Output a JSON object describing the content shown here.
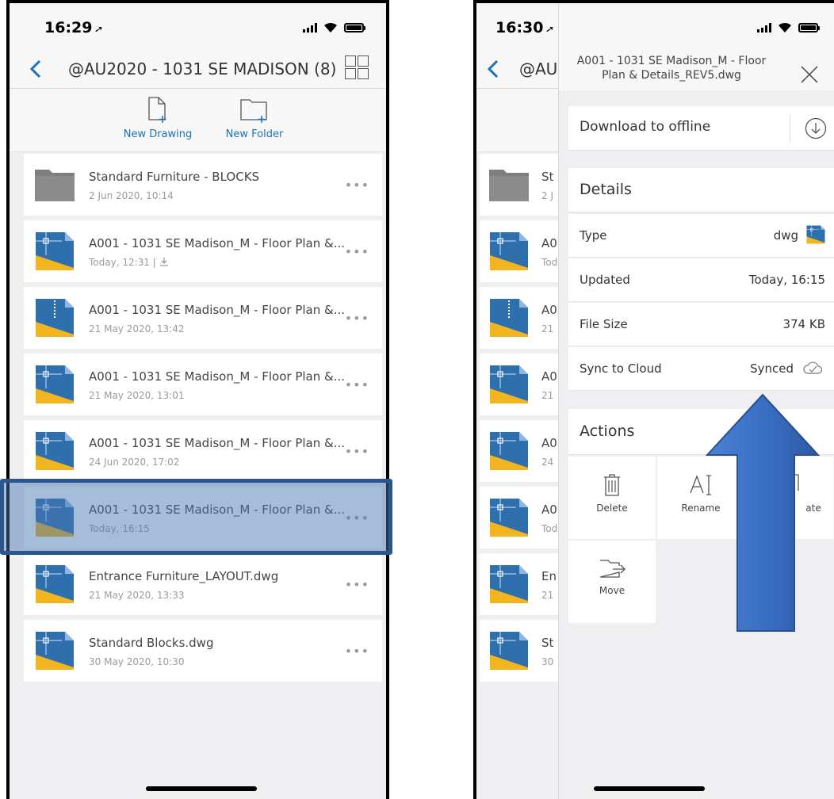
{
  "left_phone": {
    "status": {
      "time": "16:29",
      "location_glyph": "➚"
    },
    "nav": {
      "title": "@AU2020 - 1031 SE MADISON (8)"
    },
    "toolbar": {
      "new_drawing": "New Drawing",
      "new_folder": "New Folder"
    },
    "rows": [
      {
        "name": "Standard Furniture - BLOCKS",
        "date": "2 Jun 2020, 10:14",
        "icon": "folder-icon"
      },
      {
        "name": "A001 - 1031 SE Madison_M - Floor Plan &...",
        "date": "Today, 12:31  |",
        "icon": "dwg-file-icon",
        "downloaded": true
      },
      {
        "name": "A001 - 1031 SE Madison_M - Floor Plan &...",
        "date": "21 May 2020, 13:42",
        "icon": "dwg-zip-icon"
      },
      {
        "name": "A001 - 1031 SE Madison_M - Floor Plan &...",
        "date": "21 May 2020, 13:01",
        "icon": "dwg-file-icon"
      },
      {
        "name": "A001 - 1031 SE Madison_M - Floor Plan &...",
        "date": "24 Jun 2020, 17:02",
        "icon": "dwg-file-icon"
      },
      {
        "name": "A001 - 1031 SE Madison_M - Floor Plan &...",
        "date": "Today, 16:15",
        "icon": "dwg-file-icon",
        "selected": true
      },
      {
        "name": "Entrance Furniture_LAYOUT.dwg",
        "date": "21 May 2020, 13:33",
        "icon": "dwg-file-icon"
      },
      {
        "name": "Standard Blocks.dwg",
        "date": "30 May 2020, 10:30",
        "icon": "dwg-file-icon"
      }
    ],
    "more_glyph": "•••"
  },
  "right_phone": {
    "status": {
      "time": "16:30",
      "location_glyph": "➚"
    },
    "nav": {
      "title_partial": "@AU"
    },
    "bg_rows": [
      {
        "name": "St",
        "date": "2 J"
      },
      {
        "name": "A0",
        "date": "Tod"
      },
      {
        "name": "A0",
        "date": "21"
      },
      {
        "name": "A0",
        "date": "21"
      },
      {
        "name": "A0",
        "date": "24"
      },
      {
        "name": "A0",
        "date": "Tod"
      },
      {
        "name": "En",
        "date": "21"
      },
      {
        "name": "St",
        "date": "30"
      }
    ],
    "sheet": {
      "title_line1": "A001 - 1031 SE Madison_M - Floor",
      "title_line2": "Plan & Details_REV5.dwg",
      "download_label": "Download to offline",
      "details_heading": "Details",
      "details": [
        {
          "label": "Type",
          "value": "dwg"
        },
        {
          "label": "Updated",
          "value": "Today, 16:15"
        },
        {
          "label": "File Size",
          "value": "374 KB"
        },
        {
          "label": "Sync to Cloud",
          "value": "Synced"
        }
      ],
      "actions_heading": "Actions",
      "actions": [
        {
          "label": "Delete",
          "icon": "trash-icon"
        },
        {
          "label": "Rename",
          "icon": "rename-icon"
        },
        {
          "label": "ate",
          "icon": "duplicate-icon"
        },
        {
          "label": "Move",
          "icon": "move-icon"
        }
      ]
    }
  },
  "colors": {
    "accent": "#1b72b5",
    "highlight": "#2a568c",
    "arrow": "#3b6fc4",
    "dwg_blue": "#2e6fad",
    "dwg_yellow": "#f2b51f"
  }
}
